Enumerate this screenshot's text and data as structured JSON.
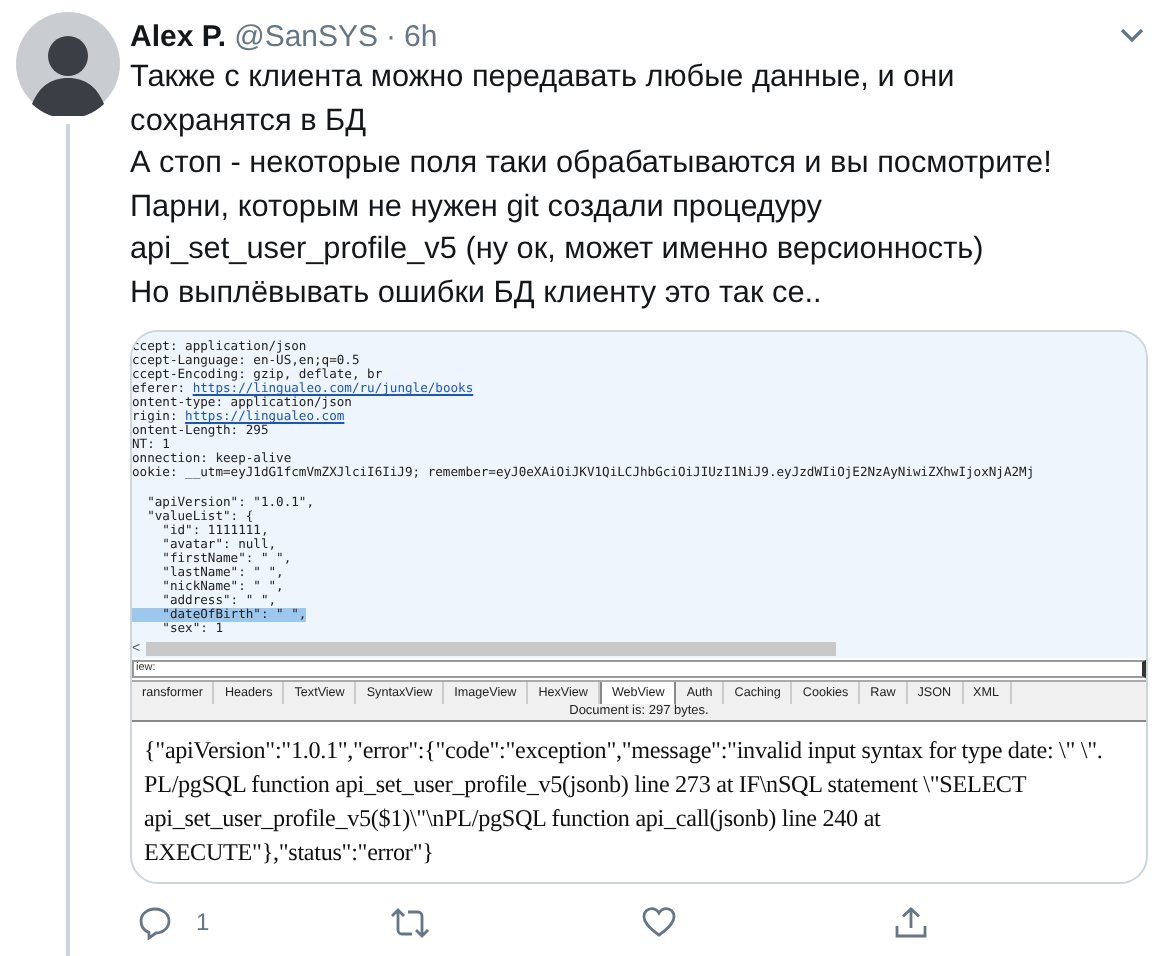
{
  "tweet": {
    "author": "Alex P.",
    "handle": "@SanSYS",
    "separator": "·",
    "time": "6h",
    "paragraphs": [
      "Также с клиента можно передавать любые данные, и они сохранятся в БД",
      "А стоп - некоторые поля таки обрабатываются и вы посмотрите!",
      "Парни, которым не нужен git создали процедуру",
      "api_set_user_profile_v5 (ну ок, может именно версионность)",
      "Но выплёвывать ошибки БД клиенту это так се.."
    ]
  },
  "attachment": {
    "headers": [
      {
        "text": "ccept: application/json",
        "selected": false
      },
      {
        "text": "ccept-Language: en-US,en;q=0.5",
        "selected": false
      },
      {
        "text": "ccept-Encoding: gzip, deflate, br",
        "selected": false
      },
      {
        "text": "eferer: ",
        "link": "https://lingualeo.com/ru/jungle/books",
        "selected": false
      },
      {
        "text": "ontent-type: application/json",
        "selected": false
      },
      {
        "text": "rigin: ",
        "link": "https://lingualeo.com",
        "selected": false
      },
      {
        "text": "ontent-Length: 295",
        "selected": false
      },
      {
        "text": "NT: 1",
        "selected": false
      },
      {
        "text": "onnection: keep-alive",
        "selected": false
      },
      {
        "text": "ookie: __utm=eyJ1dG1fcmVmZXJlciI6IiJ9; remember=eyJ0eXAiOiJKV1QiLCJhbGciOiJIUzI1NiJ9.eyJzdWIiOjE2NzAyNiwiZXhwIjoxNjA2Mj",
        "selected": false
      }
    ],
    "body": [
      {
        "text": "  \"apiVersion\": \"1.0.1\",",
        "selected": false
      },
      {
        "text": "  \"valueList\": {",
        "selected": false
      },
      {
        "text": "    \"id\": 1111111,",
        "selected": false
      },
      {
        "text": "    \"avatar\": null,",
        "selected": false
      },
      {
        "text": "    \"firstName\": \" \",",
        "selected": false
      },
      {
        "text": "    \"lastName\": \" \",",
        "selected": false
      },
      {
        "text": "    \"nickName\": \" \",",
        "selected": false
      },
      {
        "text": "    \"address\": \" \",",
        "selected": false
      },
      {
        "text": "    \"dateOfBirth\": \" \",",
        "selected": true
      },
      {
        "text": "    \"sex\": 1",
        "selected": false
      }
    ],
    "scroll_arrow": "<",
    "view_field": {
      "value": "iew:"
    },
    "tabs": [
      {
        "label": "ransformer",
        "selected": false
      },
      {
        "label": "Headers",
        "selected": false
      },
      {
        "label": "TextView",
        "selected": false
      },
      {
        "label": "SyntaxView",
        "selected": false
      },
      {
        "label": "ImageView",
        "selected": false
      },
      {
        "label": "HexView",
        "selected": false
      },
      {
        "label": "WebView",
        "selected": true
      },
      {
        "label": "Auth",
        "selected": false
      },
      {
        "label": "Caching",
        "selected": false
      },
      {
        "label": "Cookies",
        "selected": false
      },
      {
        "label": "Raw",
        "selected": false
      },
      {
        "label": "JSON",
        "selected": false
      },
      {
        "label": "XML",
        "selected": false
      }
    ],
    "status": "Document is: 297 bytes.",
    "response_lines": [
      "{\"apiVersion\":\"1.0.1\",\"error\":{\"code\":\"exception\",\"message\":\"invalid input syntax for type date: \\\" \\\".",
      "PL/pgSQL function api_set_user_profile_v5(jsonb) line 273 at IF\\nSQL statement \\\"SELECT",
      "api_set_user_profile_v5($1)\\\"\\nPL/pgSQL function api_call(jsonb) line 240 at",
      "EXECUTE\"},\"status\":\"error\"}"
    ]
  },
  "actions": [
    {
      "kind": "reply",
      "count": "1"
    },
    {
      "kind": "retweet"
    },
    {
      "kind": "like"
    },
    {
      "kind": "share"
    }
  ]
}
